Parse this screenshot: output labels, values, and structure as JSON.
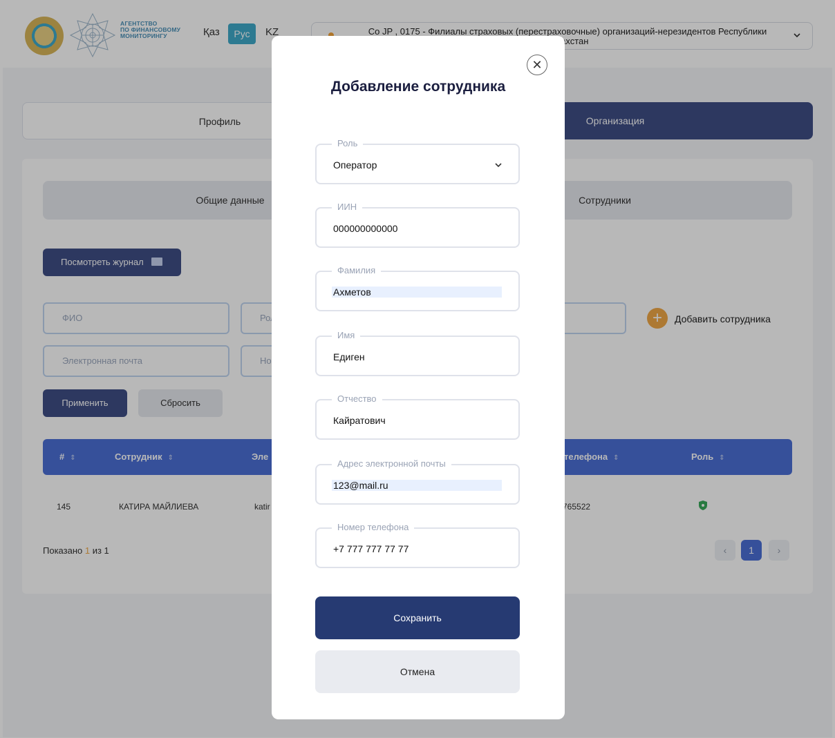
{
  "header": {
    "logo_text": [
      "АГЕНТСТВО",
      "ПО ФИНАНСОВОМУ",
      "МОНИТОРИНГУ"
    ],
    "langs": [
      "Қаз",
      "Рус",
      "KZ"
    ],
    "org_selector": "Со JP , 0175 - Филиалы страховых (перестраховочные) организаций-нерезидентов Республики Казахстан"
  },
  "tabs": {
    "profile": "Профиль",
    "organization": "Организация"
  },
  "sub_tabs": {
    "general": "Общие данные",
    "staff": "Сотрудники"
  },
  "actions": {
    "view_log": "Посмотреть журнал",
    "add_employee": "Добавить сотрудника",
    "apply": "Применить",
    "reset": "Сбросить"
  },
  "filters": {
    "fio": "ФИО",
    "role": "Роль",
    "email": "Электронная почта",
    "number": "Но"
  },
  "table": {
    "headers": [
      "#",
      "Сотрудник",
      "Эле",
      "телефона",
      "Роль"
    ],
    "rows": [
      {
        "id": "145",
        "employee": "КАТИРА МАЙЛИЕВА",
        "email": "katir",
        "phone": "765522"
      }
    ]
  },
  "pagination": {
    "shown_label": "Показано",
    "shown_count": "1",
    "of_label": "из 1",
    "current_page": "1"
  },
  "modal": {
    "title": "Добавление сотрудника",
    "fields": {
      "role": {
        "label": "Роль",
        "value": "Оператор"
      },
      "iin": {
        "label": "ИИН",
        "value": "000000000000"
      },
      "last_name": {
        "label": "Фамилия",
        "value": "Ахметов"
      },
      "first_name": {
        "label": "Имя",
        "value": "Едиген"
      },
      "middle_name": {
        "label": "Отчество",
        "value": "Кайратович"
      },
      "email": {
        "label": "Адрес электронной почты",
        "value": "123@mail.ru"
      },
      "phone": {
        "label": "Номер телефона",
        "value": "+7 777 777 77 77"
      }
    },
    "save": "Сохранить",
    "cancel": "Отмена"
  },
  "colors": {
    "primary": "#3f4e86",
    "accent": "#f0a847",
    "table_header": "#4b6fd6",
    "save_button": "#263a72"
  }
}
